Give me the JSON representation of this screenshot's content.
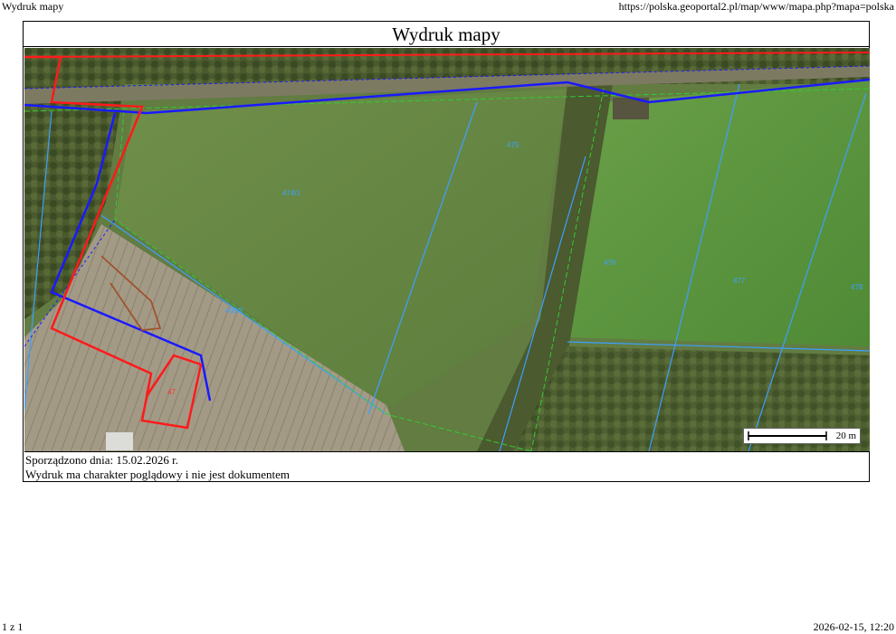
{
  "page": {
    "header_left": "Wydruk mapy",
    "header_right": "https://polska.geoportal2.pl/map/www/mapa.php?mapa=polska",
    "footer_left": "1 z 1",
    "footer_right": "2026-02-15, 12:20"
  },
  "map": {
    "title": "Wydruk mapy",
    "scale_label": "20 m",
    "parcel_labels": [
      "474/1",
      "475",
      "476",
      "477",
      "478",
      "47",
      "408/2"
    ],
    "layers": {
      "orthophoto": "grass-field",
      "parcel_boundary_color": "#3ca0ff",
      "road_boundary_color": "#1a1aff",
      "selection_color": "#ff1a1a",
      "building_outline_color": "#a0522d",
      "green_dashed_color": "#33cc33"
    }
  },
  "notes": {
    "generated": "Sporządzono dnia: 15.02.2026 r.",
    "disclaimer": "Wydruk ma charakter poglądowy i nie jest dokumentem"
  }
}
